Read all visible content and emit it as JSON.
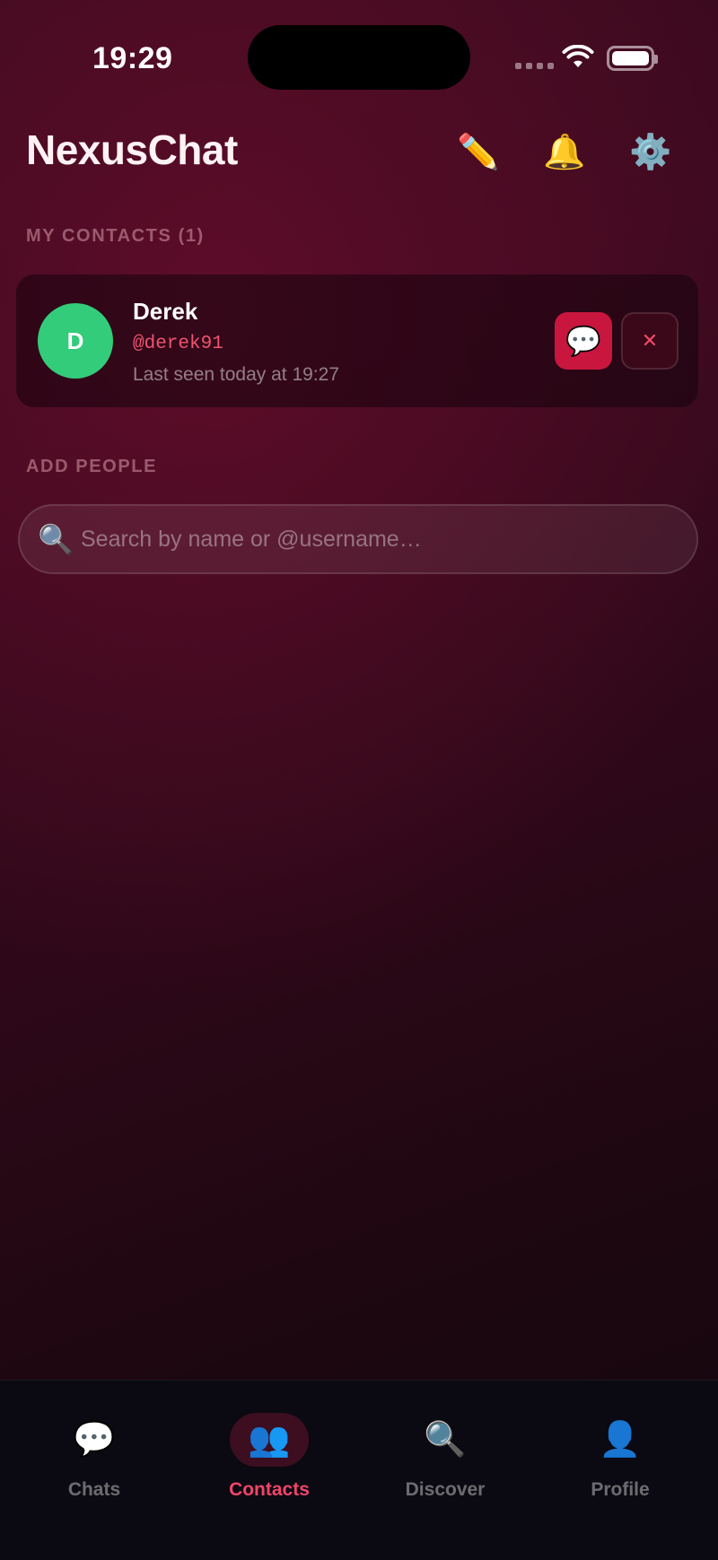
{
  "status_bar": {
    "time": "19:29",
    "icons": [
      "signal-icon",
      "wifi-icon",
      "battery-icon"
    ]
  },
  "header": {
    "title": "NexusChat",
    "actions": [
      {
        "icon": "pencil-icon",
        "glyph": "✏️"
      },
      {
        "icon": "bell-icon",
        "glyph": "🔔"
      },
      {
        "icon": "gear-icon",
        "glyph": "⚙️"
      }
    ]
  },
  "contacts_section": {
    "label": "MY CONTACTS (1)",
    "items": [
      {
        "initial": "D",
        "name": "Derek",
        "username": "@derek91",
        "last_seen": "Last seen today at 19:27",
        "avatar_color": "#33cc7a",
        "message_glyph": "💬",
        "remove_glyph": "✕"
      }
    ]
  },
  "add_people": {
    "label": "ADD PEOPLE",
    "search_icon_glyph": "🔍",
    "search_placeholder": "Search by name or @username…",
    "search_value": ""
  },
  "tabs": [
    {
      "label": "Chats",
      "icon": "chat-bubble-icon",
      "glyph": "💬",
      "active": false
    },
    {
      "label": "Contacts",
      "icon": "people-icon",
      "glyph": "👥",
      "active": true
    },
    {
      "label": "Discover",
      "icon": "magnifier-icon",
      "glyph": "🔍",
      "active": false
    },
    {
      "label": "Profile",
      "icon": "person-icon",
      "glyph": "👤",
      "active": false
    }
  ],
  "colors": {
    "accent": "#f0456a",
    "primary_button": "#c8163f",
    "username": "#ee5470",
    "avatar": "#33cc7a",
    "tab_bar_bg": "#0b0a12"
  }
}
